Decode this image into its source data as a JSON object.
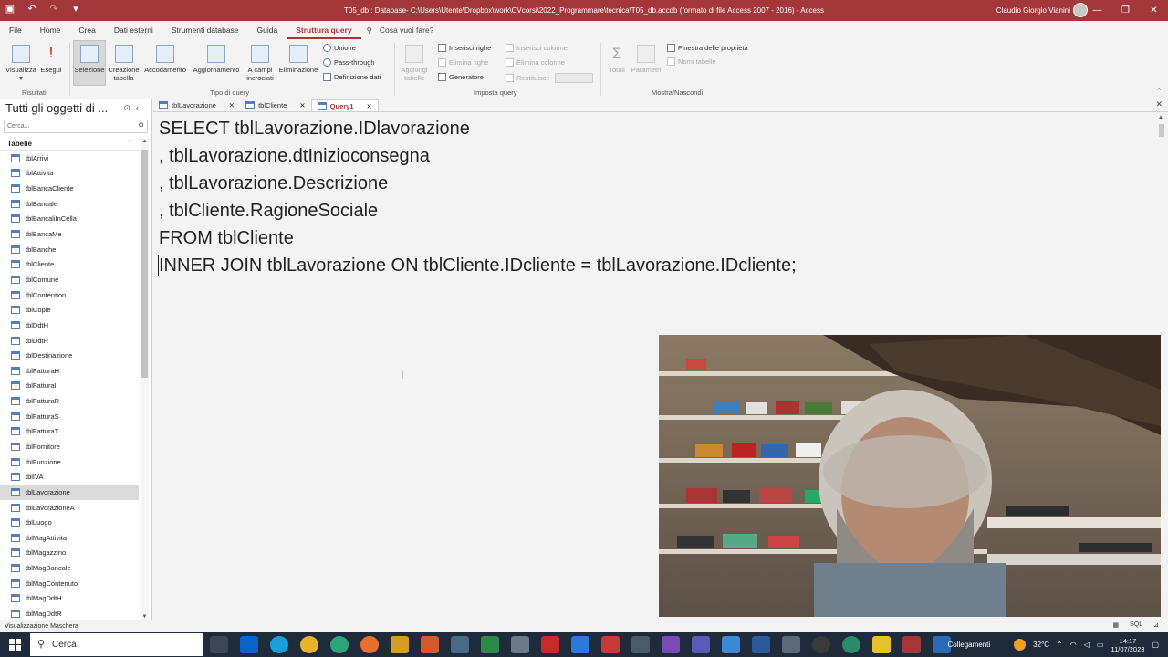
{
  "window": {
    "title": "T05_db : Database- C:\\Users\\Utente\\Dropbox\\work\\CVcorsi\\2022_Programmare\\tecnica\\T05_db.accdb (formato di file Access 2007 - 2016)  -  Access",
    "user": "Claudio Giorgio Vianini"
  },
  "ribbon_tabs": [
    "File",
    "Home",
    "Crea",
    "Dati esterni",
    "Strumenti database",
    "Guida",
    "Struttura query"
  ],
  "tell_me": "Cosa vuoi fare?",
  "ribbon": {
    "results": {
      "visualizza": "Visualizza",
      "esegui": "Esegui",
      "group": "Risultati"
    },
    "query_type": {
      "selezione": "Selezione",
      "creazione": "Creazione tabella",
      "accodamento": "Accodamento",
      "aggiornamento": "Aggiornamento",
      "campi_incrociati": "A campi incrociati",
      "eliminazione": "Eliminazione",
      "unione": "Unione",
      "pass_through": "Pass-through",
      "definizione_dati": "Definizione dati",
      "group": "Tipo di query"
    },
    "query_setup": {
      "aggiungi_tabelle": "Aggiungi tabelle",
      "inserisci_righe": "Inserisci righe",
      "elimina_righe": "Elimina righe",
      "generatore": "Generatore",
      "inserisci_colonne": "Inserisci colonne",
      "elimina_colonne": "Elimina colonne",
      "restituisci": "Restituisci:",
      "group": "Imposta query"
    },
    "show_hide": {
      "totali": "Totali",
      "parametri": "Parametri",
      "finestra_proprieta": "Finestra delle proprietà",
      "nomi_tabelle": "Nomi tabelle",
      "group": "Mostra/Nascondi"
    }
  },
  "nav": {
    "title": "Tutti gli oggetti di ...",
    "search_placeholder": "Cerca...",
    "section": "Tabelle",
    "tables": [
      "tblArrivi",
      "tblAttivita",
      "tblBancaCliente",
      "tblBancale",
      "tblBancaliInCella",
      "tblBancaMe",
      "tblBanche",
      "tblCliente",
      "tblComune",
      "tblContention",
      "tblCopie",
      "tblDdtH",
      "tblDdtR",
      "tblDestinazione",
      "tblFatturaH",
      "tblFatturaI",
      "tblFatturaR",
      "tblFatturaS",
      "tblFatturaT",
      "tblFornitore",
      "tblFunzione",
      "tblIVA",
      "tblLavorazione",
      "tblLavorazioneA",
      "tblLuogo",
      "tblMagAttivita",
      "tblMagazzino",
      "tblMagBancale",
      "tblMagContenuto",
      "tblMagDdtH",
      "tblMagDdtR"
    ],
    "active_index": 22
  },
  "doc_tabs": [
    {
      "label": "tblLavorazione",
      "active": false
    },
    {
      "label": "tblCliente",
      "active": false
    },
    {
      "label": "Query1",
      "active": true
    }
  ],
  "sql_lines": [
    "SELECT tblLavorazione.IDlavorazione",
    ", tblLavorazione.dtInizioconsegna",
    ", tblLavorazione.Descrizione",
    ", tblCliente.RagioneSociale",
    "FROM tblCliente",
    "INNER JOIN tblLavorazione ON tblCliente.IDcliente = tblLavorazione.IDcliente;"
  ],
  "status": {
    "text": "Visualizzazione Maschera",
    "sql_view": "SQL"
  },
  "taskbar": {
    "search": "Cerca",
    "network": "Collegamenti",
    "temperature": "32°C",
    "time": "14:17",
    "date": "11/07/2023"
  },
  "colors": {
    "accent": "#a4373a",
    "taskbar": "#1f2b3a"
  }
}
